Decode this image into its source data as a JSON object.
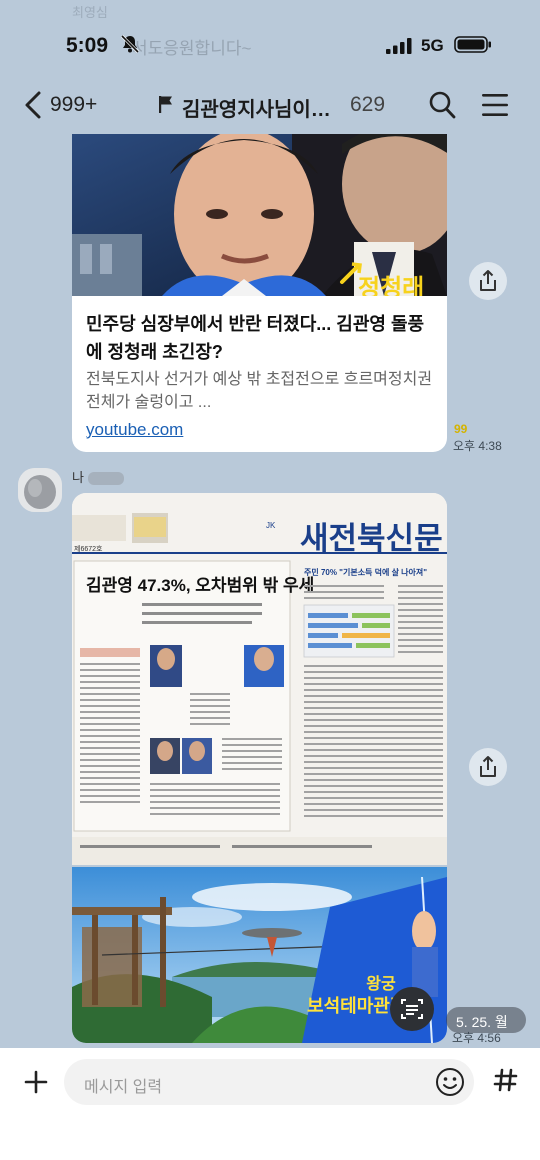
{
  "status_bar": {
    "time": "5:09",
    "network": "5G",
    "ghost_preview": "서도응원합니다~",
    "ghost_top": "최영심"
  },
  "header": {
    "back_count": "999+",
    "title": "김관영지사님이…",
    "member_count": "629"
  },
  "link_card": {
    "title": "민주당 심장부에서 반란 터졌다... 김관영 돌풍에 정청래 초긴장?",
    "description": "전북도지사 선거가 예상 밖 초접전으로 흐르며정치권 전체가 술렁이고 ...",
    "domain": "youtube.com",
    "thumb_caption": "정청래"
  },
  "message1": {
    "unread": "99",
    "time": "오후 4:38"
  },
  "message2": {
    "sender": "나",
    "date_badge": "5. 25. 월",
    "time": "오후 4:56"
  },
  "newspaper": {
    "masthead": "새전북신문",
    "headline": "김관영 47.3%, 오차범위 밖 우세",
    "side_headline": "주민 70% \"기본소득 덕에 살 나아져\"",
    "issue": "제6672호"
  },
  "ad": {
    "title1": "왕궁",
    "title2": "보석테마관광지"
  },
  "composer": {
    "placeholder": "메시지 입력"
  },
  "colors": {
    "chat_bg": "#b9c9d9",
    "link": "#1a5fb4",
    "unread": "#d4b300",
    "masthead_blue": "#1a3f8a",
    "ad_yellow": "#ffe23a"
  }
}
